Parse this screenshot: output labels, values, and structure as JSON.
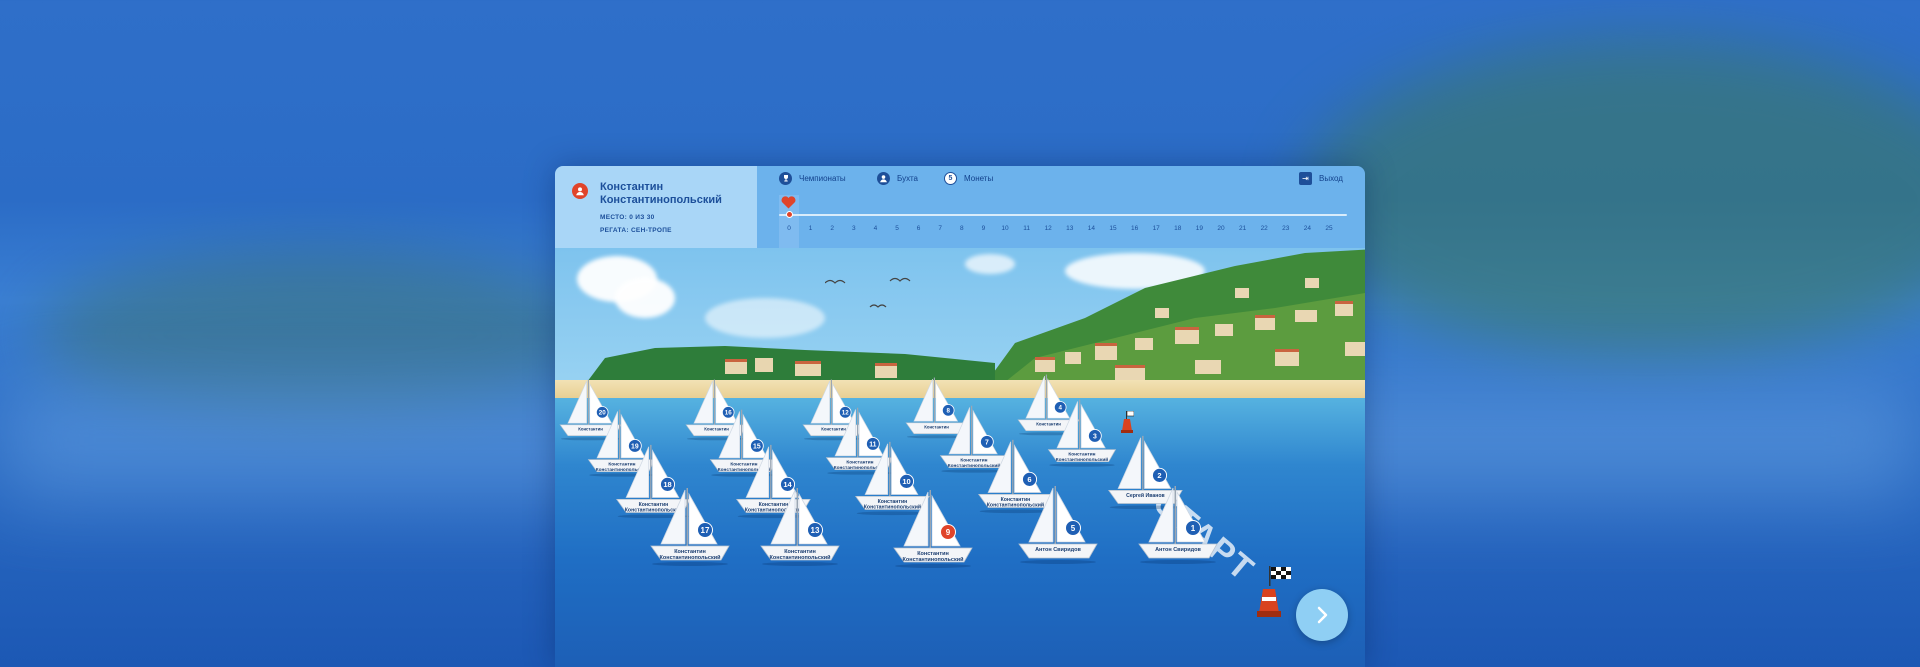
{
  "player": {
    "name": "Константин Константинопольский",
    "place_label": "МЕСТО: 0 ИЗ 30",
    "regatta_label": "РЕГАТА: СЕН-ТРОПЕ"
  },
  "nav": {
    "championships": "Чемпионаты",
    "bay": "Бухта",
    "coins": "Монеты",
    "coins_value": "5",
    "exit": "Выход"
  },
  "track": {
    "current": 0,
    "ticks": [
      "0",
      "1",
      "2",
      "3",
      "4",
      "5",
      "6",
      "7",
      "8",
      "9",
      "10",
      "11",
      "12",
      "13",
      "14",
      "15",
      "16",
      "17",
      "18",
      "19",
      "20",
      "21",
      "22",
      "23",
      "24",
      "25"
    ]
  },
  "scene": {
    "start_label": "СТАРТ",
    "boats": [
      {
        "num": "20",
        "name": "Константин"
      },
      {
        "num": "16",
        "name": "Константин"
      },
      {
        "num": "12",
        "name": "Константин"
      },
      {
        "num": "8",
        "name": "Константин"
      },
      {
        "num": "4",
        "name": "Константин"
      },
      {
        "num": "19",
        "name": "Константин Константинопольский"
      },
      {
        "num": "15",
        "name": "Константин Константинопольский"
      },
      {
        "num": "11",
        "name": "Константин Константинопольский"
      },
      {
        "num": "7",
        "name": "Константин Константинопольский"
      },
      {
        "num": "3",
        "name": "Константин Константинопольский"
      },
      {
        "num": "18",
        "name": "Константин Константинопольский"
      },
      {
        "num": "14",
        "name": "Константин Константинопольский"
      },
      {
        "num": "10",
        "name": "Константин Константинопольский"
      },
      {
        "num": "6",
        "name": "Константин Константинопольский"
      },
      {
        "num": "2",
        "name": "Сергей Иванов"
      },
      {
        "num": "17",
        "name": "Константин Константинопольский"
      },
      {
        "num": "13",
        "name": "Константин Константинопольский"
      },
      {
        "num": "9",
        "name": "Константин Константинопольский",
        "me": true
      },
      {
        "num": "5",
        "name": "Антон Свиридов"
      },
      {
        "num": "1",
        "name": "Антон Свиридов"
      }
    ]
  },
  "colors": {
    "accent": "#1f5fb4",
    "player_marker": "#e0442a"
  }
}
